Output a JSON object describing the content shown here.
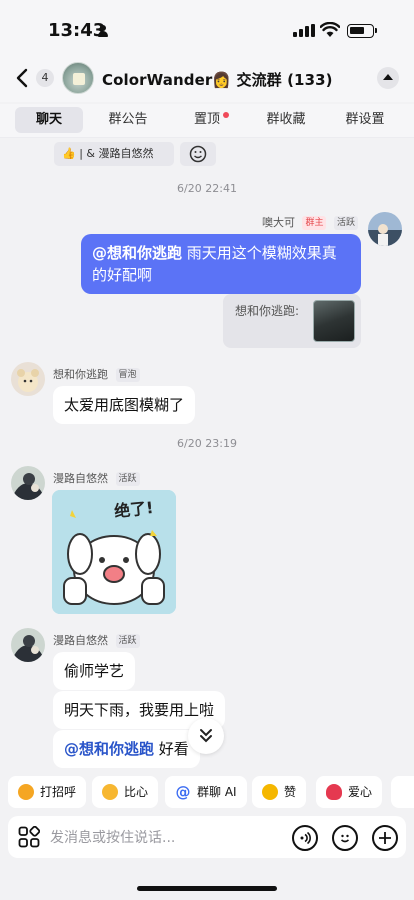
{
  "status_bar": {
    "time": "13:43"
  },
  "header": {
    "unread_count": "4",
    "title": "ColorWander👩 交流群 (133)"
  },
  "tabs": [
    {
      "label": "聊天",
      "active": true
    },
    {
      "label": "群公告",
      "active": false
    },
    {
      "label": "置顶",
      "active": false,
      "badge_dot": true
    },
    {
      "label": "群收藏",
      "active": false
    },
    {
      "label": "群设置",
      "active": false
    }
  ],
  "reactions": {
    "chip_text": "👍 | & 漫路自悠然"
  },
  "messages": {
    "ts1": "6/20 22:41",
    "m1": {
      "sender": "噢大可",
      "tag_owner": "群主",
      "tag_active": "活跃",
      "mention": "@想和你逃跑",
      "text": " 雨天用这个模糊效果真的好配啊",
      "quote_text": "想和你逃跑:"
    },
    "m2": {
      "sender": "想和你逃跑",
      "tag": "冒泡",
      "text": "太爱用底图模糊了"
    },
    "ts2": "6/20 23:19",
    "m3": {
      "sender": "漫路自悠然",
      "tag": "活跃",
      "sticker_text": "绝了!"
    },
    "m4": {
      "sender": "漫路自悠然",
      "tag": "活跃",
      "b1": "偷师学艺",
      "b2": "明天下雨，我要用上啦",
      "b3_mention": "@想和你逃跑",
      "b3_text": " 好看"
    }
  },
  "quick_actions": [
    {
      "label": "打招呼",
      "icon": "wave-icon",
      "color": "#f5a623"
    },
    {
      "label": "比心",
      "icon": "heart-hand-icon",
      "color": "#f7b731"
    },
    {
      "label": "群聊 AI",
      "icon": "at-icon",
      "color": "#3d6df2"
    },
    {
      "label": "赞",
      "icon": "thumbs-up-icon",
      "color": "#f5b700"
    },
    {
      "label": "爱心",
      "icon": "heart-icon",
      "color": "#e53950"
    }
  ],
  "input": {
    "placeholder": "发消息或按住说话..."
  },
  "colors": {
    "my_bubble": "#5b73f6",
    "mention": "#2a55c9",
    "background": "#f2f2f4"
  }
}
